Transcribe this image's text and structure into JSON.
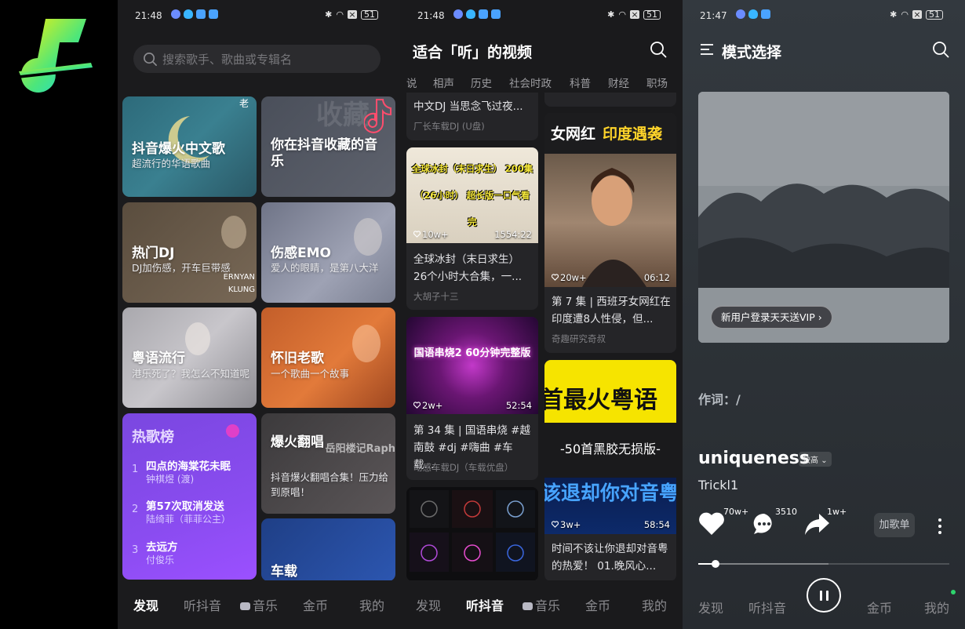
{
  "screen1": {
    "status": {
      "time": "21:48",
      "battery": "51"
    },
    "search_placeholder": "搜索歌手、歌曲或专辑名",
    "cards": [
      {
        "title": "抖音爆火中文歌",
        "subtitle": "超流行的华语歌曲",
        "badge": "老"
      },
      {
        "title": "你在抖音收藏的音乐",
        "subtitle": "",
        "badge": "收藏"
      },
      {
        "title": "热门DJ",
        "subtitle": "DJ加伤感，开车巨带感",
        "badge": "ERNYAN KLUNG"
      },
      {
        "title": "伤感EMO",
        "subtitle": "爱人的眼睛，是第八大洋",
        "badge": ""
      },
      {
        "title": "粤语流行",
        "subtitle": "港乐死了？我怎么不知道呢",
        "badge": ""
      },
      {
        "title": "怀旧老歌",
        "subtitle": "一个歌曲一个故事",
        "badge": ""
      },
      {
        "title": "爆火翻唱",
        "subtitle": "抖音爆火翻唱合集！压力给到原唱！",
        "badge": "岳阳楼记Raph"
      },
      {
        "title": "车载",
        "subtitle": "",
        "badge": ""
      }
    ],
    "ranking": {
      "title": "热歌榜",
      "items": [
        {
          "no": "1",
          "title": "四点的海棠花未眠",
          "artist": "钟棋煜 (渡)"
        },
        {
          "no": "2",
          "title": "第57次取消发送",
          "artist": "陆绮菲（菲菲公主）"
        },
        {
          "no": "3",
          "title": "去远方",
          "artist": "付俊乐"
        }
      ]
    },
    "nav": [
      "发现",
      "听抖音",
      "音乐",
      "金币",
      "我的"
    ],
    "nav_active": 0
  },
  "screen2": {
    "status": {
      "time": "21:48",
      "battery": "51"
    },
    "title": "适合「听」的视频",
    "categories": [
      "说",
      "相声",
      "历史",
      "社会时政",
      "科普",
      "财经",
      "职场"
    ],
    "videos_left": [
      {
        "title": "中文DJ 当思念飞过夜...",
        "author": "厂长车载DJ (U盘)",
        "likes": "",
        "duration": "",
        "overlay": ""
      },
      {
        "title": "全球冰封（末日求生）26个小时大合集，一...",
        "author": "大胡子十三",
        "likes": "10w+",
        "duration": "1554:22",
        "overlay": "全球冰封（末日求生） 200集（26小时） 超长版一口气看完"
      },
      {
        "title": "第 34 集 | 国语串烧 #越南鼓 #dj #嗨曲 #车载...",
        "author": "动感车载DJ（车载优盘）",
        "likes": "2w+",
        "duration": "52:54",
        "overlay": "国语串烧2 60分钟完整版"
      },
      {
        "title": "",
        "author": "",
        "likes": "",
        "duration": "",
        "overlay": ""
      }
    ],
    "videos_right": [
      {
        "title": "第 7 集 | 西班牙女网红在印度遭8人性侵，但...",
        "author": "奇趣研究奇叔",
        "likes": "20w+",
        "duration": "06:12",
        "overlay_a": "女网红",
        "overlay_b": "印度遇袭"
      },
      {
        "title": "时间不该让你退却对音粤的热爱！ 01.晚风心...",
        "author": "",
        "likes": "3w+",
        "duration": "58:54",
        "overlay_a": "首最火粤语",
        "overlay_b": "-50首黑胶无损版-",
        "overlay_c": "该退却你对音粤"
      }
    ],
    "nav": [
      "发现",
      "听抖音",
      "音乐",
      "金币",
      "我的"
    ],
    "nav_active": 1
  },
  "screen3": {
    "status": {
      "time": "21:47",
      "battery": "51"
    },
    "title": "模式选择",
    "vip_banner": "新用户登录天天送VIP",
    "lyric_label": "作词：/",
    "song": "uniqueness",
    "quality": "较高",
    "artist": "Trickl1",
    "likes": "70w+",
    "comments": "3510",
    "shares": "1w+",
    "add_playlist": "加歌单",
    "progress": 0.07,
    "buffered": 0.52,
    "nav": [
      "发现",
      "听抖音",
      "金币",
      "我的"
    ]
  },
  "colors": {
    "accent_purple": "#8a4cf0",
    "brand_green": "#26e07f",
    "brand_yellow": "#f4f011",
    "bg_dark": "#1b1b1d"
  }
}
